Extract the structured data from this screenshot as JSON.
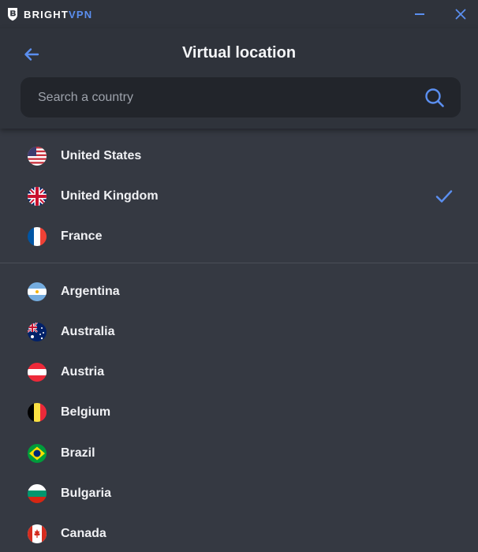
{
  "app": {
    "brand_primary": "BRIGHT",
    "brand_accent": "VPN",
    "accent_color": "#5b8ff0"
  },
  "window_controls": {
    "minimize_icon": "minimize-icon",
    "close_icon": "close-icon"
  },
  "header": {
    "title": "Virtual location",
    "back_icon": "arrow-left-icon"
  },
  "search": {
    "placeholder": "Search a country",
    "value": "",
    "icon": "search-icon"
  },
  "recent_locations": [
    {
      "name": "United States",
      "flag": "us-flag-icon",
      "selected": false
    },
    {
      "name": "United Kingdom",
      "flag": "uk-flag-icon",
      "selected": true
    },
    {
      "name": "France",
      "flag": "france-flag-icon",
      "selected": false
    }
  ],
  "all_locations": [
    {
      "name": "Argentina",
      "flag": "argentina-flag-icon"
    },
    {
      "name": "Australia",
      "flag": "australia-flag-icon"
    },
    {
      "name": "Austria",
      "flag": "austria-flag-icon"
    },
    {
      "name": "Belgium",
      "flag": "belgium-flag-icon"
    },
    {
      "name": "Brazil",
      "flag": "brazil-flag-icon"
    },
    {
      "name": "Bulgaria",
      "flag": "bulgaria-flag-icon"
    },
    {
      "name": "Canada",
      "flag": "canada-flag-icon"
    }
  ],
  "selected_icon": "checkmark-icon"
}
